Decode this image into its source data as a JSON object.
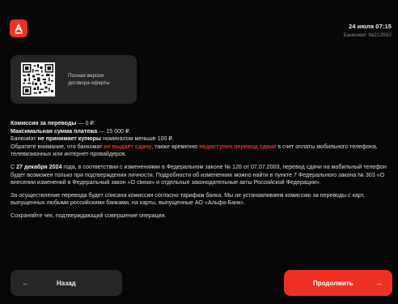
{
  "header": {
    "logo_icon": "alfa-bank-logo",
    "datetime": "24 июля 07:15",
    "atm_label": "Банкомат №213592"
  },
  "qr_card": {
    "icon": "qr-code-icon",
    "line1": "Полная версия",
    "line2": "договора-оферты"
  },
  "info": {
    "commission_label": "Комиссия за переводы",
    "commission_value": " — 0 ₽.",
    "max_label": "Максимальная сумма платежа",
    "max_value": " — 15 000 ₽.",
    "coupons_pre": "Банкомат ",
    "coupons_bold": "не принимает купюры",
    "coupons_post": " номиналом меньше 100 ₽.",
    "notice_pre": "Обратите внимание, что банкомат ",
    "notice_red1": "не выдаёт сдачу",
    "notice_mid": ", также временно ",
    "notice_red2": "недоступен перевод сдачи",
    "notice_post": " в счет оплаты мобильного телефона, телевизионных или интернет-провайдеров.",
    "law_pre": "С ",
    "law_bold": "27 декабря 2024",
    "law_post": " года, в соответствии с изменениями в Федеральном законе № 126 от 07.07.2003, перевод сдачи на мобильный телефон будет возможен только при подтверждении личности. Подробности об изменениях можно найти в пункте 7 Федерального закона № 303 «О внесении изменений в Федеральный закон «О связи» и отдельные законодательные акты Российской Федерации».",
    "fee_text": "За осуществление перевода будет списана комиссия согласно тарифам банка. Мы не устанавливаем комиссию за переводы с карт, выпущенных любыми российскими банками, на карты, выпущенные АО «Альфа-Банк».",
    "receipt_text": "Сохраняйте чек, подтверждающий совершение операции."
  },
  "buttons": {
    "back_label": "Назад",
    "back_icon": "arrow-left-icon",
    "next_label": "Продолжить",
    "next_icon": "arrow-right-icon"
  },
  "colors": {
    "accent": "#ef3124",
    "background": "#070707",
    "card": "#262626"
  }
}
